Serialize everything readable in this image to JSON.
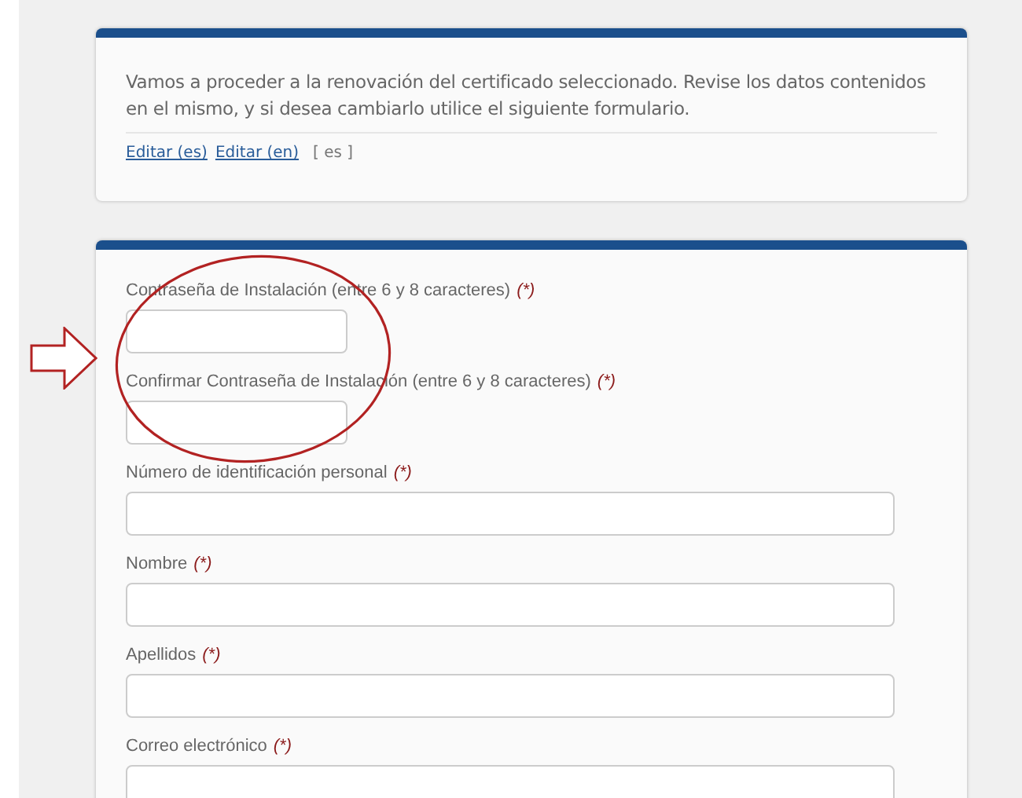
{
  "intro": {
    "message": "Vamos a proceder a la renovación del certificado seleccionado. Revise los datos contenidos en el mismo, y si desea cambiarlo utilice el siguiente formulario.",
    "links": [
      "Editar (es)",
      "Editar (en)"
    ],
    "language": "[ es ]"
  },
  "form": {
    "fields": [
      {
        "label": "Contraseña de Instalación (entre 6 y 8 caracteres)",
        "required_mark": "(*)",
        "kind": "short"
      },
      {
        "label": "Confirmar Contraseña de Instalación (entre 6 y 8 caracteres)",
        "required_mark": "(*)",
        "kind": "short"
      },
      {
        "label": "Número de identificación personal",
        "required_mark": "(*)",
        "kind": "wide"
      },
      {
        "label": "Nombre",
        "required_mark": "(*)",
        "kind": "wide"
      },
      {
        "label": "Apellidos",
        "required_mark": "(*)",
        "kind": "wide"
      },
      {
        "label": "Correo electrónico",
        "required_mark": "(*)",
        "kind": "wide"
      }
    ]
  }
}
